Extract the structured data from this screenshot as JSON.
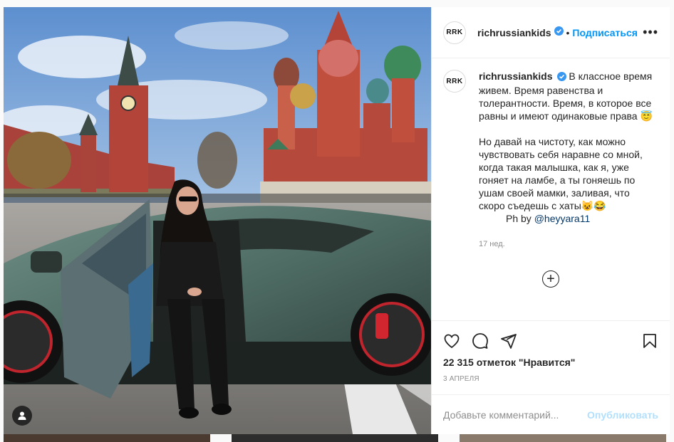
{
  "post": {
    "username": "richrussiankids",
    "avatar_text": "RRK",
    "follow_label": "Подписаться",
    "separator": "•",
    "more_label": "•••",
    "caption_p1": "В классное время живем. Время равенства и толерантности. Время, в которое все равны и имеют одинаковые права 😇",
    "caption_p2": "Но давай на чистоту, как можно чувствовать себя наравне со мной, когда такая малышка, как я, уже гоняет на ламбе, а ты гоняешь по ушам своей мамки, заливая, что скоро съедешь с хаты😺😂",
    "credit_prefix": "Ph by ",
    "credit_mention": "@heyyara11",
    "caption_time": "17 нед.",
    "load_more_label": "+",
    "likes": "22 315 отметок \"Нравится\"",
    "date": "3 АПРЕЛЯ",
    "comment_placeholder": "Добавьте комментарий...",
    "post_button": "Опубликовать"
  },
  "icons": {
    "like": "heart-icon",
    "comment": "comment-icon",
    "share": "share-icon",
    "save": "bookmark-icon",
    "verified": "verified-badge-icon",
    "tag": "user-tag-icon"
  },
  "colors": {
    "accent": "#0095f6",
    "post_disabled": "#b2dffc",
    "verified": "#3897f0"
  }
}
